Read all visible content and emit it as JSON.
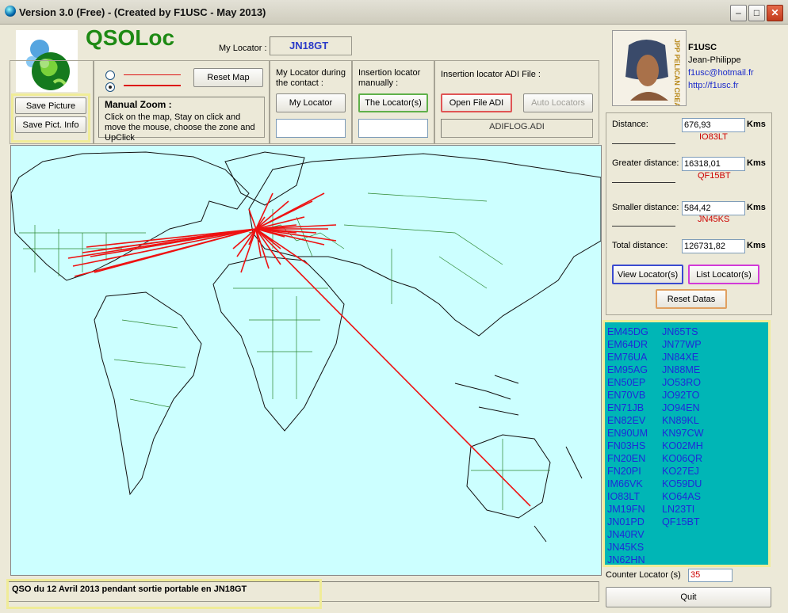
{
  "window": {
    "title": "Version 3.0 (Free) - (Created by F1USC - May 2013)"
  },
  "app": {
    "name": "QSOLoc"
  },
  "my_locator": {
    "label": "My Locator :",
    "value": "JN18GT"
  },
  "picture_buttons": {
    "save": "Save Picture",
    "save_info": "Save Pict. Info"
  },
  "map_controls": {
    "reset": "Reset Map",
    "zoom_title": "Manual Zoom :",
    "zoom_help": "Click on the map, Stay on click and move the mouse, choose the zone and UpClick"
  },
  "contact_locator": {
    "label": "My Locator during the contact :",
    "button": "My Locator",
    "value": ""
  },
  "manual_locator": {
    "label": "Insertion locator manually :",
    "button": "The Locator(s)",
    "value": ""
  },
  "adi": {
    "label": "Insertion locator ADI File :",
    "open_button": "Open File ADI",
    "auto_button": "Auto Locators",
    "file": "ADIFLOG.ADI"
  },
  "author": {
    "call": "F1USC",
    "name": "Jean-Philippe",
    "email": "f1usc@hotmail.fr",
    "url": "http://f1usc.fr",
    "photo_caption": "JPP PELICAN CREATIVE"
  },
  "stats": {
    "unit": "Kms",
    "distance": {
      "label": "Distance:",
      "value": "676,93",
      "locator": "IO83LT"
    },
    "greater": {
      "label": "Greater distance:",
      "value": "16318,01",
      "locator": "QF15BT"
    },
    "smaller": {
      "label": "Smaller distance:",
      "value": "584,42",
      "locator": "JN45KS"
    },
    "total": {
      "label": "Total distance:",
      "value": "126731,82"
    }
  },
  "action_buttons": {
    "view": "View Locator(s)",
    "list": "List Locator(s)",
    "reset": "Reset Datas",
    "quit": "Quit"
  },
  "locators_col1": [
    "EM45DG",
    "EM64DR",
    "EM76UA",
    "EM95AG",
    "EN50EP",
    "EN70VB",
    "EN71JB",
    "EN82EV",
    "EN90UM",
    "FN03HS",
    "FN20EN",
    "FN20PI",
    "IM66VK",
    "IO83LT",
    "JM19FN",
    "JN01PD",
    "JN40RV",
    "JN45KS",
    "JN62HN"
  ],
  "locators_col2": [
    "JN65TS",
    "JN77WP",
    "JN84XE",
    "JN88ME",
    "JO53RO",
    "JO92TO",
    "JO94EN",
    "KN89KL",
    "KN97CW",
    "KO02MH",
    "KO06QR",
    "KO27EJ",
    "KO59DU",
    "KO64AS",
    "LN23TI",
    "QF15BT"
  ],
  "counter": {
    "label": "Counter Locator (s)",
    "value": "35"
  },
  "comment": {
    "value": "QSO du 12 Avril 2013 pendant sortie portable en JN18GT"
  },
  "colors": {
    "map_sea": "#ccffff",
    "line": "#ee1111",
    "list_bg": "#00b6b6",
    "list_text": "#1e2ad8",
    "highlight": "#f0ec98"
  }
}
